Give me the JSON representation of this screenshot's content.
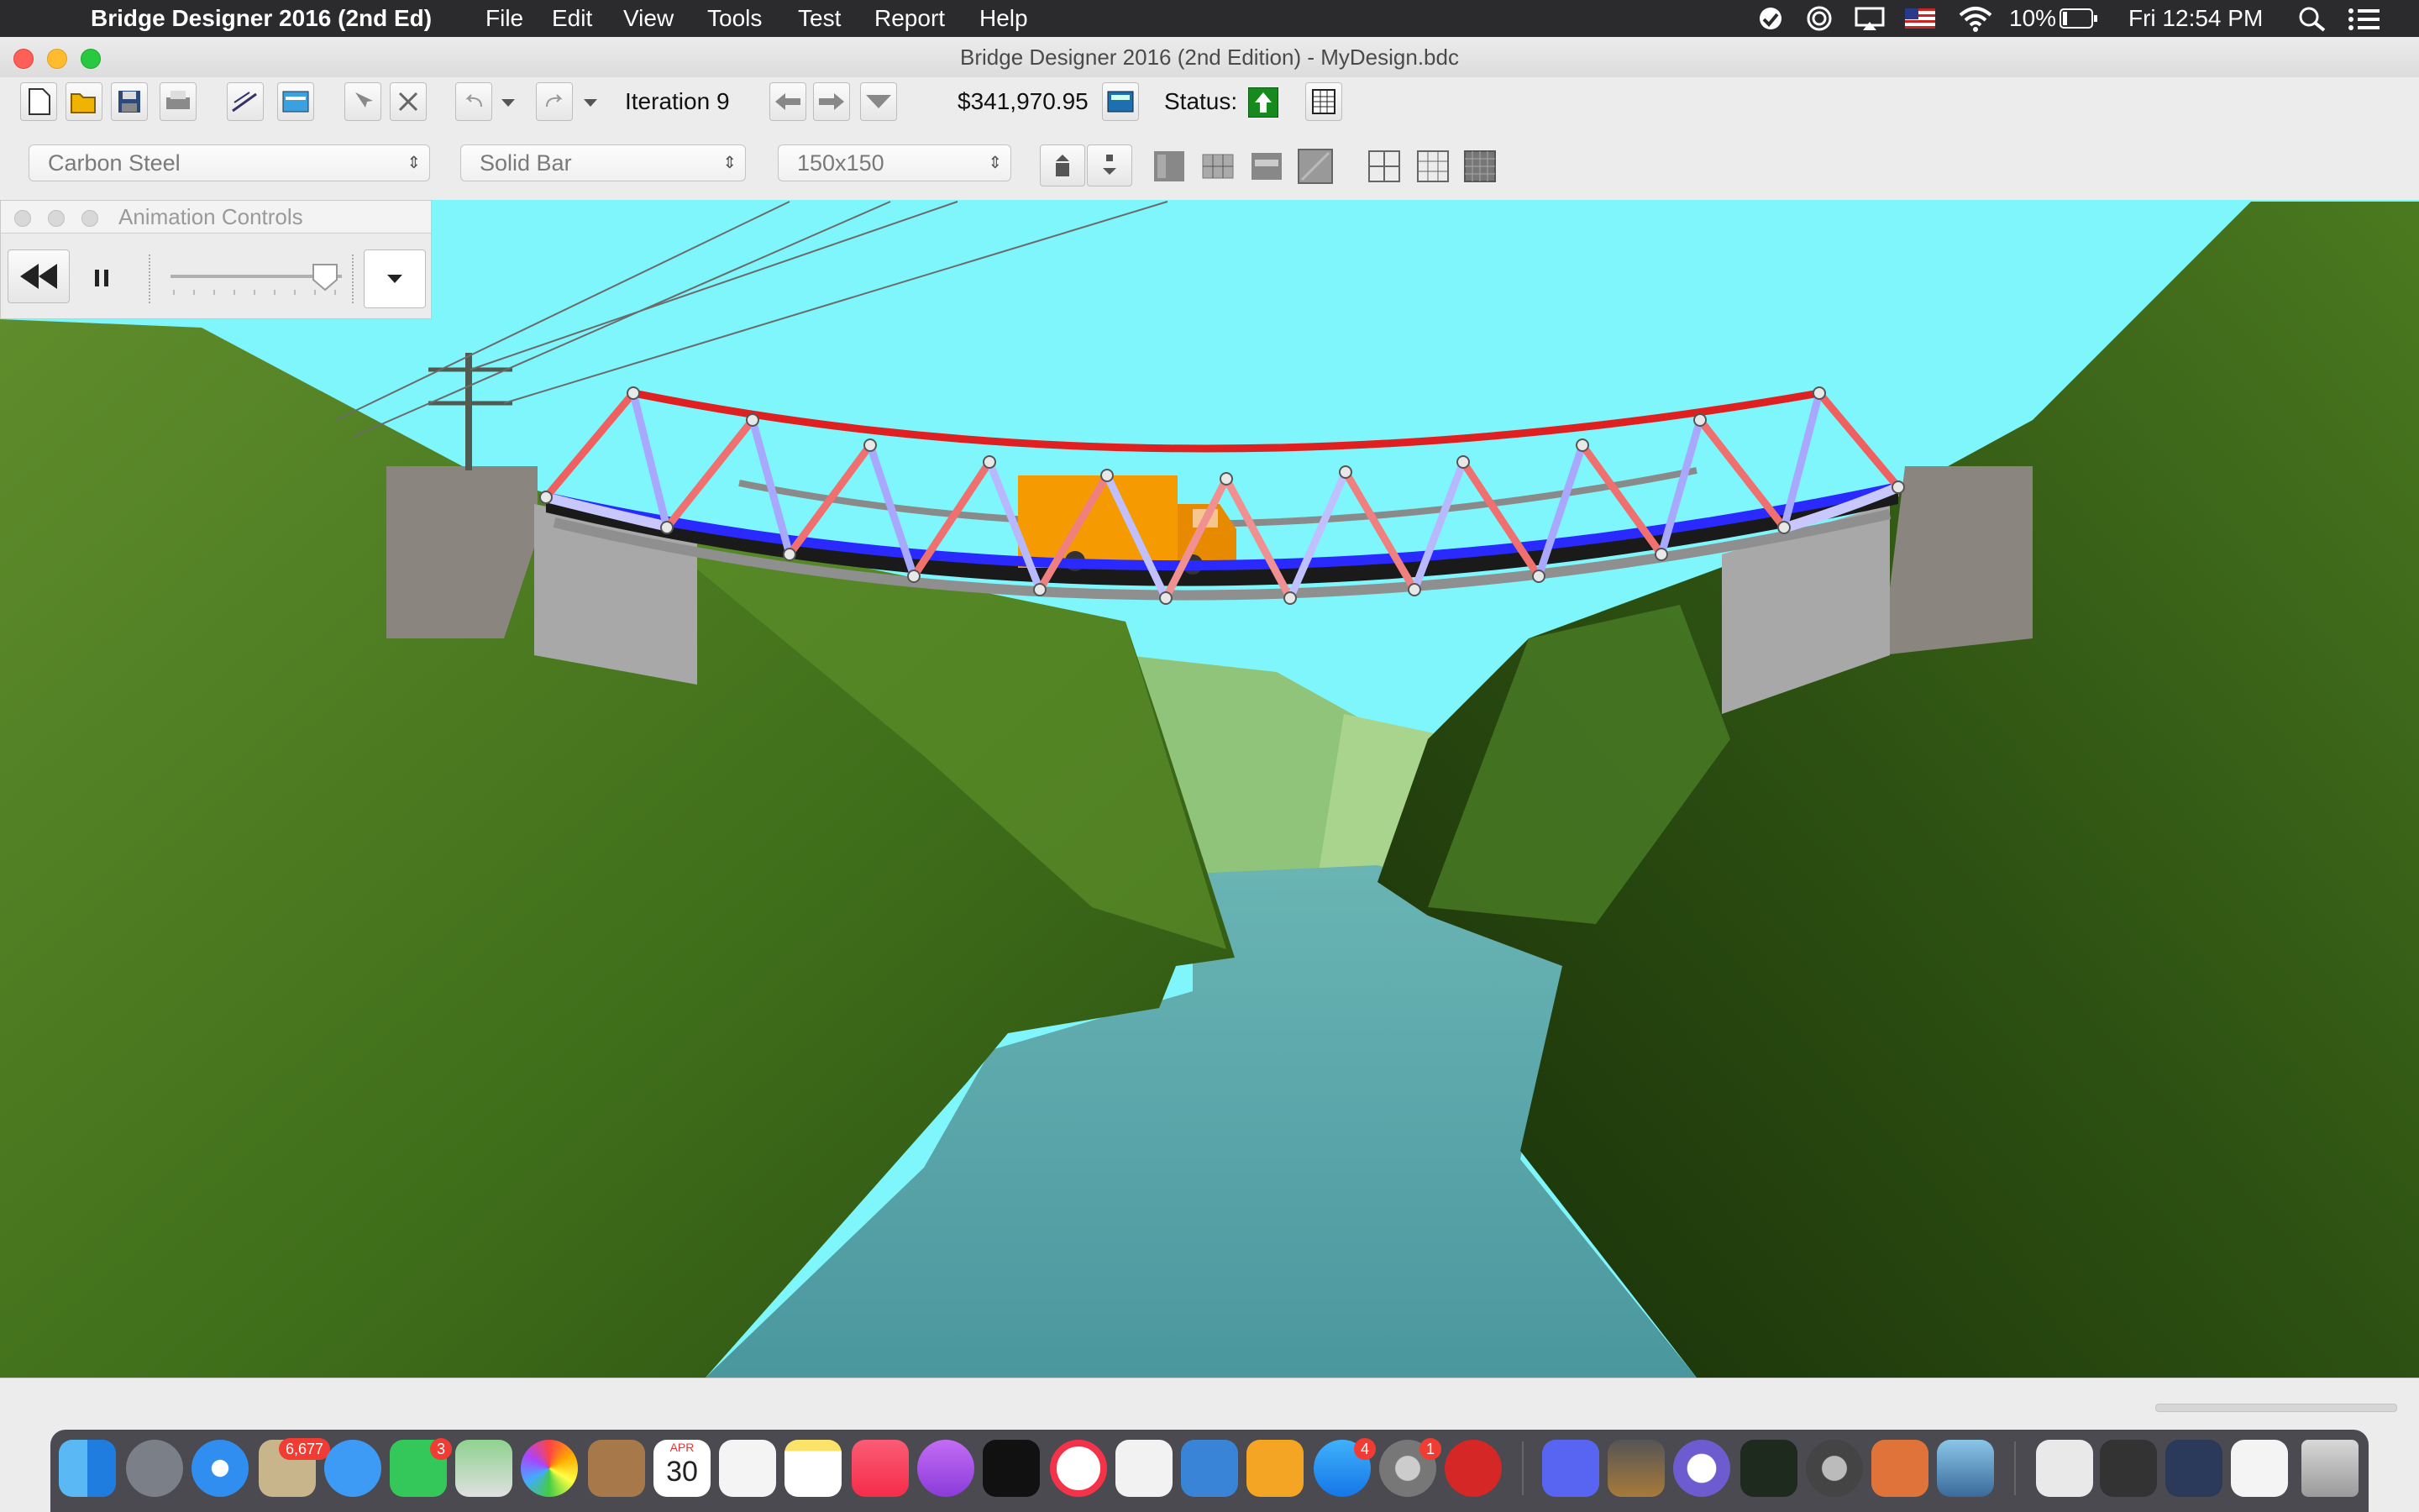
{
  "menubar": {
    "app_name": "Bridge Designer 2016 (2nd Ed)",
    "menus": [
      "File",
      "Edit",
      "View",
      "Tools",
      "Test",
      "Report",
      "Help"
    ],
    "battery": "10%",
    "clock": "Fri 12:54 PM"
  },
  "window": {
    "title": "Bridge Designer 2016 (2nd Edition) - MyDesign.bdc"
  },
  "toolbar": {
    "iteration_label": "Iteration 9",
    "cost": "$341,970.95",
    "status_label": "Status:"
  },
  "selectors": {
    "material": "Carbon Steel",
    "section": "Solid Bar",
    "size": "150x150"
  },
  "animation_controls": {
    "title": "Animation Controls",
    "speed_level": 0.9
  },
  "dock": {
    "mail_badge": "6,677",
    "facetime_badge": "3",
    "appstore_badge": "4",
    "prefs_badge": "1",
    "calendar_month": "APR",
    "calendar_day": "30"
  },
  "colors": {
    "tension": "#e83030",
    "compression": "#2a2aff",
    "sky": "#7ff6fb",
    "water": "#4d9aa0",
    "hills": "#4e7a22"
  }
}
